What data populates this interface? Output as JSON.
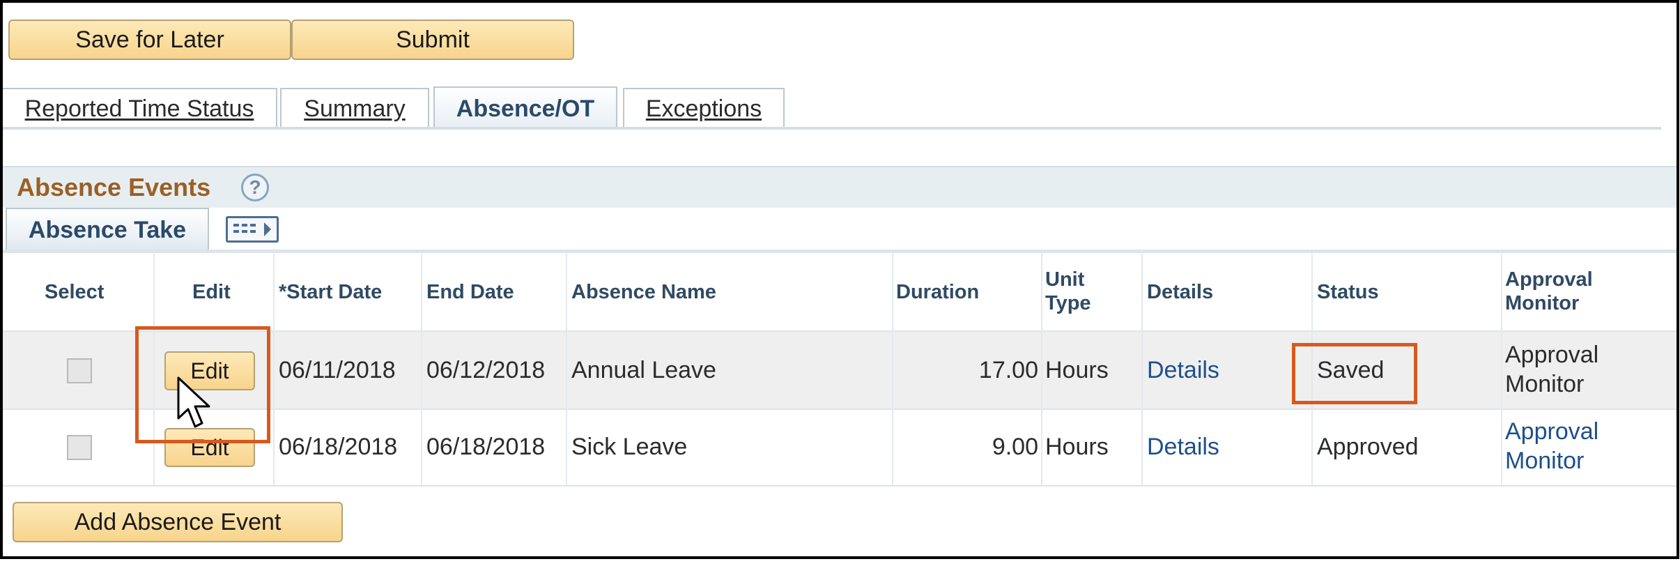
{
  "toolbar": {
    "save_for_later": "Save for Later",
    "submit": "Submit"
  },
  "tabs": [
    {
      "label": "Reported Time Status",
      "active": false
    },
    {
      "label": "Summary",
      "active": false
    },
    {
      "label": "Absence/OT",
      "active": true
    },
    {
      "label": "Exceptions",
      "active": false
    }
  ],
  "section": {
    "title": "Absence Events",
    "help_icon": "question-mark-icon",
    "subtab": "Absence Take",
    "grid_icon": "grid-view-icon"
  },
  "table": {
    "headers": {
      "select": "Select",
      "edit": "Edit",
      "start_date": "*Start Date",
      "end_date": "End Date",
      "absence_name": "Absence Name",
      "duration": "Duration",
      "unit_type_1": "Unit",
      "unit_type_2": "Type",
      "details": "Details",
      "status": "Status",
      "approval_monitor_1": "Approval",
      "approval_monitor_2": "Monitor"
    },
    "rows": [
      {
        "edit": "Edit",
        "start_date": "06/11/2018",
        "end_date": "06/12/2018",
        "absence_name": "Annual Leave",
        "duration": "17.00",
        "unit_type": "Hours",
        "details": "Details",
        "status": "Saved",
        "approval_monitor_1": "Approval",
        "approval_monitor_2": "Monitor",
        "approval_is_link": false
      },
      {
        "edit": "Edit",
        "start_date": "06/18/2018",
        "end_date": "06/18/2018",
        "absence_name": "Sick Leave",
        "duration": "9.00",
        "unit_type": "Hours",
        "details": "Details",
        "status": "Approved",
        "approval_monitor_1": "Approval",
        "approval_monitor_2": "Monitor",
        "approval_is_link": true
      }
    ]
  },
  "footer": {
    "add_absence_event": "Add Absence Event"
  },
  "colors": {
    "button_fill": "#f8d48d",
    "section_title": "#9b5f24",
    "link": "#1e4f8b",
    "highlight": "#d65a1e"
  }
}
